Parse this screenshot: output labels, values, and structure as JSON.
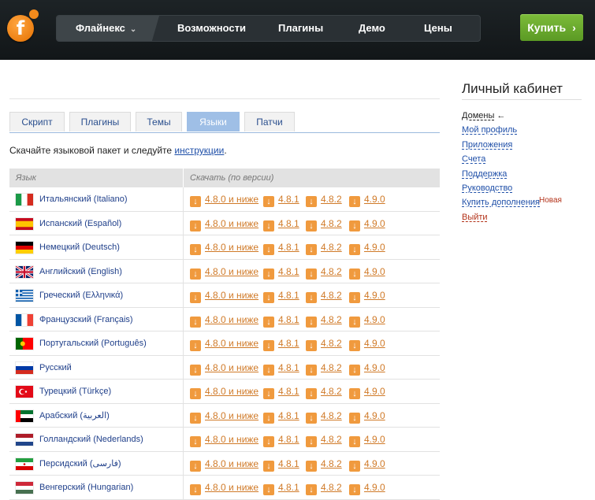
{
  "header": {
    "logo_letter": "f",
    "product": "Флайнекс",
    "nav": [
      "Возможности",
      "Плагины",
      "Демо",
      "Цены"
    ],
    "buy_label": "Купить",
    "buy_arrow": "›"
  },
  "tabs": [
    "Скрипт",
    "Плагины",
    "Темы",
    "Языки",
    "Патчи"
  ],
  "active_tab": "Языки",
  "intro": {
    "text": "Скачайте языковой пакет и следуйте ",
    "link": "инструкции",
    "tail": "."
  },
  "table": {
    "col_language": "Язык",
    "col_download": "Скачать (по версии)",
    "versions": [
      "4.8.0 и ниже",
      "4.8.1",
      "4.8.2",
      "4.9.0"
    ],
    "rows": [
      {
        "lang": "Итальянский (Italiano)",
        "flag": "it"
      },
      {
        "lang": "Испанский (Español)",
        "flag": "es"
      },
      {
        "lang": "Немецкий (Deutsch)",
        "flag": "de"
      },
      {
        "lang": "Английский (English)",
        "flag": "gb"
      },
      {
        "lang": "Греческий (Ελληνικά)",
        "flag": "gr"
      },
      {
        "lang": "Французский (Français)",
        "flag": "fr"
      },
      {
        "lang": "Португальский (Português)",
        "flag": "pt"
      },
      {
        "lang": "Русский",
        "flag": "ru"
      },
      {
        "lang": "Турецкий (Türkçe)",
        "flag": "tr"
      },
      {
        "lang": "Арабский (العربية)",
        "flag": "ae"
      },
      {
        "lang": "Голландский (Nederlands)",
        "flag": "nl"
      },
      {
        "lang": "Персидский (فارسی)",
        "flag": "ir"
      },
      {
        "lang": "Венгерский (Hungarian)",
        "flag": "hu"
      }
    ]
  },
  "sidebar": {
    "title": "Личный кабинет",
    "links": [
      {
        "label": "Домены",
        "current": true,
        "arrow": "←"
      },
      {
        "label": "Мой профиль"
      },
      {
        "label": "Приложения"
      },
      {
        "label": "Счета"
      },
      {
        "label": "Поддержка"
      },
      {
        "label": "Руководство"
      },
      {
        "label": "Купить дополнения",
        "badge": "Новая"
      },
      {
        "label": "Выйти",
        "exit": true
      }
    ]
  },
  "colors": {
    "accent": "#1f4fa8",
    "download": "#d07a28",
    "buy": "#6aab2e",
    "active_tab": "#9fbfe6"
  }
}
